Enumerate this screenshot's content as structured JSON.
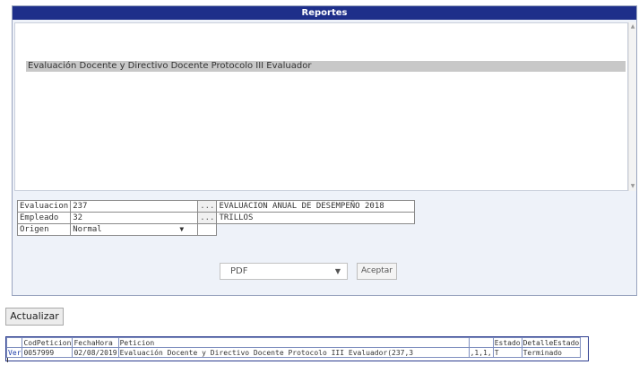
{
  "panel": {
    "title": "Reportes"
  },
  "reports": {
    "selected_item": "Evaluación Docente y Directivo Docente Protocolo III Evaluador"
  },
  "form": {
    "evaluacion": {
      "label": "Evaluacion",
      "value": "237",
      "lookup": "...",
      "description": "EVALUACION ANUAL DE DESEMPEÑO 2018"
    },
    "empleado": {
      "label": "Empleado",
      "value": "32",
      "lookup": "...",
      "description": "TRILLOS"
    },
    "origen": {
      "label": "Origen",
      "selected": "Normal"
    }
  },
  "output": {
    "format": "PDF",
    "accept_label": "Aceptar"
  },
  "refresh_label": "Actualizar",
  "results": {
    "headers": [
      "",
      "CodPeticion",
      "FechaHora",
      "Peticion",
      "",
      "Estado",
      "DetalleEstado"
    ],
    "row": {
      "link": "Ver",
      "cod": "0057999",
      "fecha": "02/08/2019",
      "peticion": "Evaluación Docente y Directivo Docente Protocolo III Evaluador(237,3",
      "extra": ",1,1,",
      "estado": "T",
      "detalle": "Terminado"
    }
  },
  "icons": {
    "dropdown_arrow": "▼",
    "scroll_up": "▲",
    "scroll_down": "▼"
  }
}
